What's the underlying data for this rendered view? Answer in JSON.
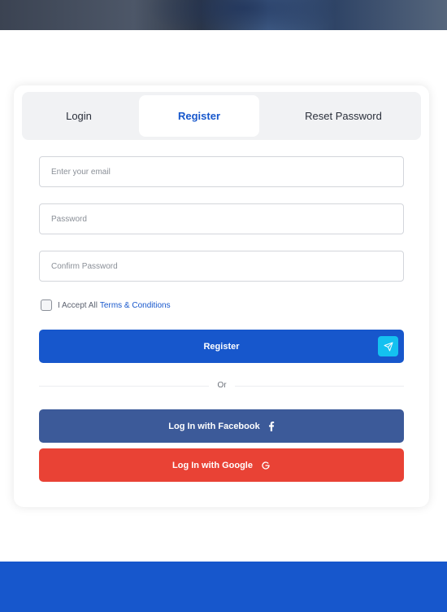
{
  "tabs": [
    {
      "label": "Login"
    },
    {
      "label": "Register"
    },
    {
      "label": "Reset Password"
    }
  ],
  "form": {
    "email_placeholder": "Enter your email",
    "password_placeholder": "Password",
    "confirm_placeholder": "Confirm Password",
    "terms_prefix": "I Accept All",
    "terms_link": "Terms & Conditions",
    "register_label": "Register",
    "or_label": "Or",
    "facebook_label": "Log In with Facebook",
    "google_label": "Log In with Google"
  },
  "colors": {
    "primary": "#1757cc",
    "accent_icon": "#14c1f0",
    "facebook": "#3c5a99",
    "google": "#e94235"
  },
  "icons": {
    "send": "paper-plane-icon",
    "facebook": "facebook-icon",
    "google": "google-icon"
  }
}
